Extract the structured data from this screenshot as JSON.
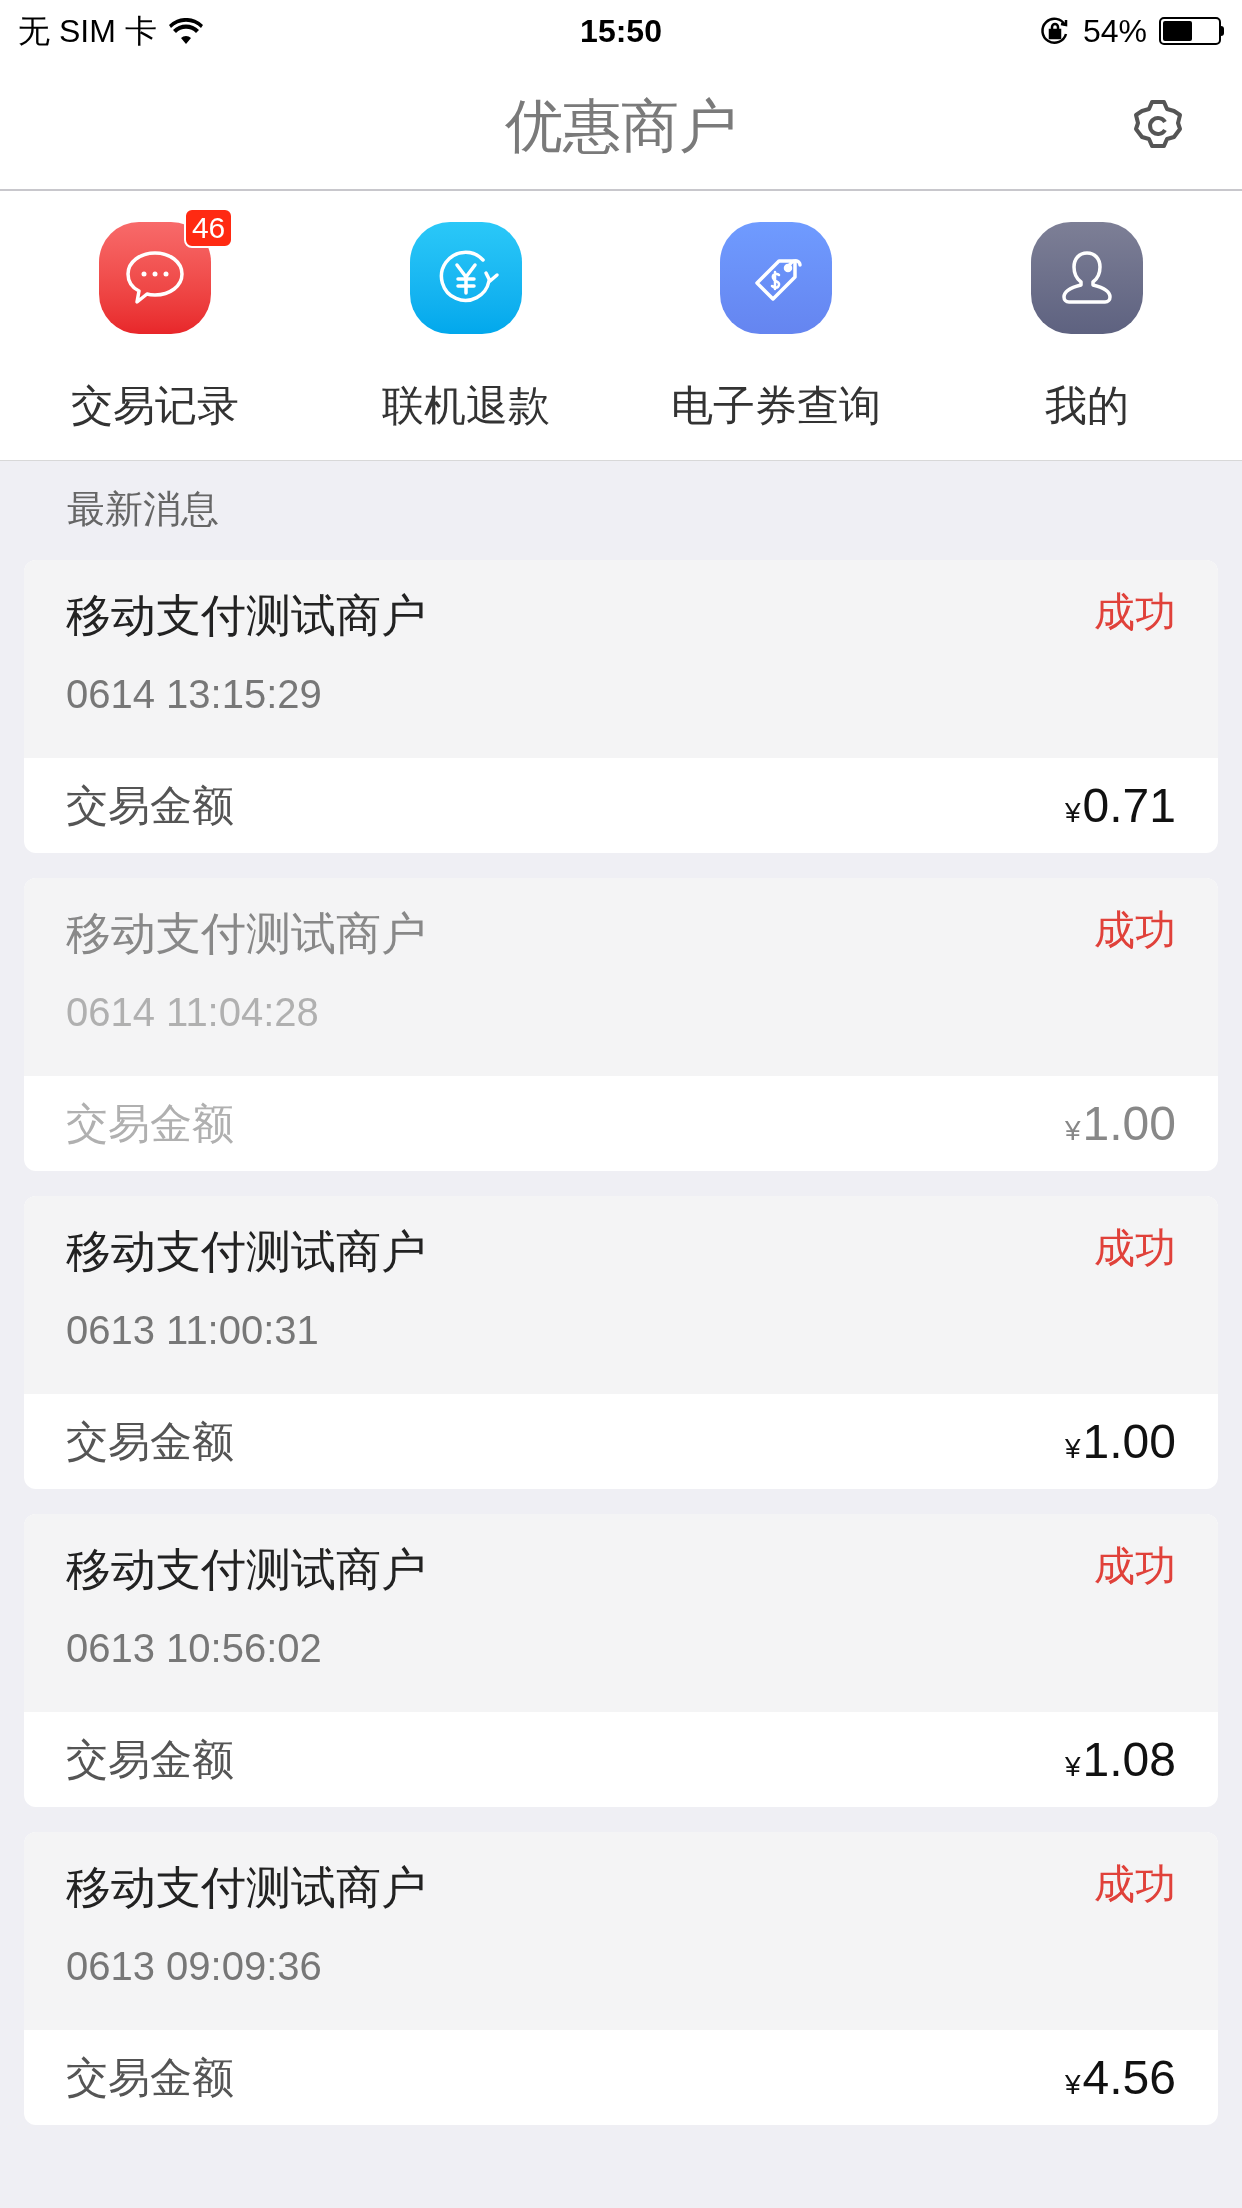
{
  "status_bar": {
    "carrier": "无 SIM 卡",
    "time": "15:50",
    "battery": "54%"
  },
  "nav_bar": {
    "title": "优惠商户"
  },
  "shortcuts": [
    {
      "kind": "chat",
      "label": "交易记录",
      "badge": "46"
    },
    {
      "kind": "refund",
      "label": "联机退款"
    },
    {
      "kind": "coupon",
      "label": "电子券查询"
    },
    {
      "kind": "profile",
      "label": "我的"
    }
  ],
  "section_title": "最新消息",
  "messages": [
    {
      "merchant": "移动支付测试商户",
      "time": "0614 13:15:29",
      "status": "成功",
      "amount_label": "交易金额",
      "currency": "¥",
      "amount": "0.71",
      "read": false
    },
    {
      "merchant": "移动支付测试商户",
      "time": "0614 11:04:28",
      "status": "成功",
      "amount_label": "交易金额",
      "currency": "¥",
      "amount": "1.00",
      "read": true
    },
    {
      "merchant": "移动支付测试商户",
      "time": "0613 11:00:31",
      "status": "成功",
      "amount_label": "交易金额",
      "currency": "¥",
      "amount": "1.00",
      "read": false
    },
    {
      "merchant": "移动支付测试商户",
      "time": "0613 10:56:02",
      "status": "成功",
      "amount_label": "交易金额",
      "currency": "¥",
      "amount": "1.08",
      "read": false
    },
    {
      "merchant": "移动支付测试商户",
      "time": "0613 09:09:36",
      "status": "成功",
      "amount_label": "交易金额",
      "currency": "¥",
      "amount": "4.56",
      "read": false
    }
  ]
}
